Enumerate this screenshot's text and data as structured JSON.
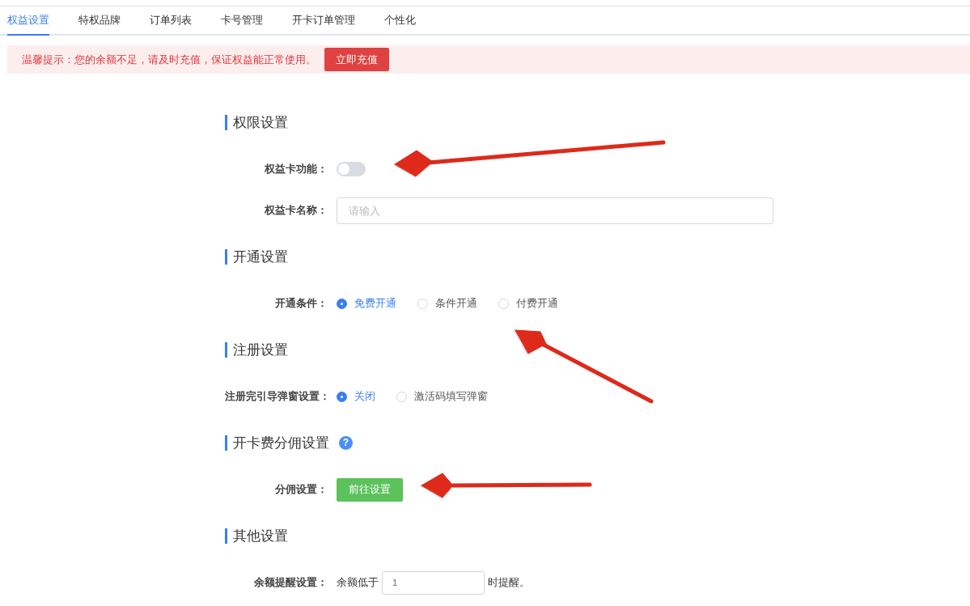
{
  "tabs": [
    {
      "label": "权益设置",
      "selected": true
    },
    {
      "label": "特权品牌",
      "selected": false
    },
    {
      "label": "订单列表",
      "selected": false
    },
    {
      "label": "卡号管理",
      "selected": false
    },
    {
      "label": "开卡订单管理",
      "selected": false
    },
    {
      "label": "个性化",
      "selected": false
    }
  ],
  "alert": {
    "text": "温馨提示：您的余额不足，请及时充值，保证权益能正常使用。",
    "button": "立即充值"
  },
  "sections": [
    {
      "title": "权限设置",
      "fields": [
        {
          "kind": "switch",
          "label": "权益卡功能：",
          "on": false
        },
        {
          "kind": "input",
          "label": "权益卡名称：",
          "placeholder": "请输入"
        }
      ]
    },
    {
      "title": "开通设置",
      "fields": [
        {
          "kind": "radio",
          "label": "开通条件：",
          "options": [
            {
              "label": "免费开通",
              "selected": true
            },
            {
              "label": "条件开通",
              "selected": false
            },
            {
              "label": "付费开通",
              "selected": false
            }
          ]
        }
      ]
    },
    {
      "title": "注册设置",
      "fields": [
        {
          "kind": "radio",
          "label": "注册完引导弹窗设置：",
          "options": [
            {
              "label": "关闭",
              "selected": true
            },
            {
              "label": "激活码填写弹窗",
              "selected": false
            }
          ]
        }
      ]
    },
    {
      "title": "开卡费分佣设置",
      "help_icon": "?",
      "fields": [
        {
          "kind": "button",
          "label": "分佣设置：",
          "button": "前往设置"
        }
      ]
    },
    {
      "title": "其他设置",
      "fields": [
        {
          "kind": "inline_input",
          "label": "余额提醒设置：",
          "prefix": "余额低于",
          "value": "1",
          "suffix": "时提醒。"
        }
      ]
    }
  ]
}
